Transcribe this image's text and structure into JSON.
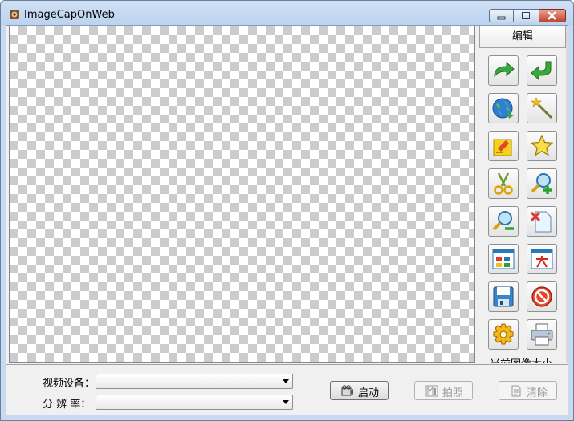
{
  "window": {
    "title": "ImageCapOnWeb"
  },
  "toolbox": {
    "header": "编辑",
    "tools": [
      {
        "icon": "redo-arrow-icon"
      },
      {
        "icon": "undo-arrow-icon"
      },
      {
        "icon": "globe-icon"
      },
      {
        "icon": "magic-wand-icon"
      },
      {
        "icon": "highlight-note-icon"
      },
      {
        "icon": "star-icon"
      },
      {
        "icon": "scissors-icon"
      },
      {
        "icon": "zoom-in-icon"
      },
      {
        "icon": "zoom-out-icon"
      },
      {
        "icon": "delete-page-icon"
      },
      {
        "icon": "color-grid-icon"
      },
      {
        "icon": "text-calendar-icon"
      },
      {
        "icon": "save-disk-icon"
      },
      {
        "icon": "cancel-icon"
      },
      {
        "icon": "settings-gear-icon"
      },
      {
        "icon": "printer-icon"
      }
    ],
    "size_label": "当前图像大小"
  },
  "controls": {
    "device_label": "视频设备：",
    "device_value": "",
    "resolution_label": "分 辨 率：",
    "resolution_value": "",
    "start_label": "启动",
    "capture_label": "拍照",
    "clear_label": "清除"
  },
  "colors": {
    "titlebar": "#c7daf2",
    "panel": "#f0f0f0",
    "checker": "#cccccc",
    "close_button": "#c5432c"
  }
}
